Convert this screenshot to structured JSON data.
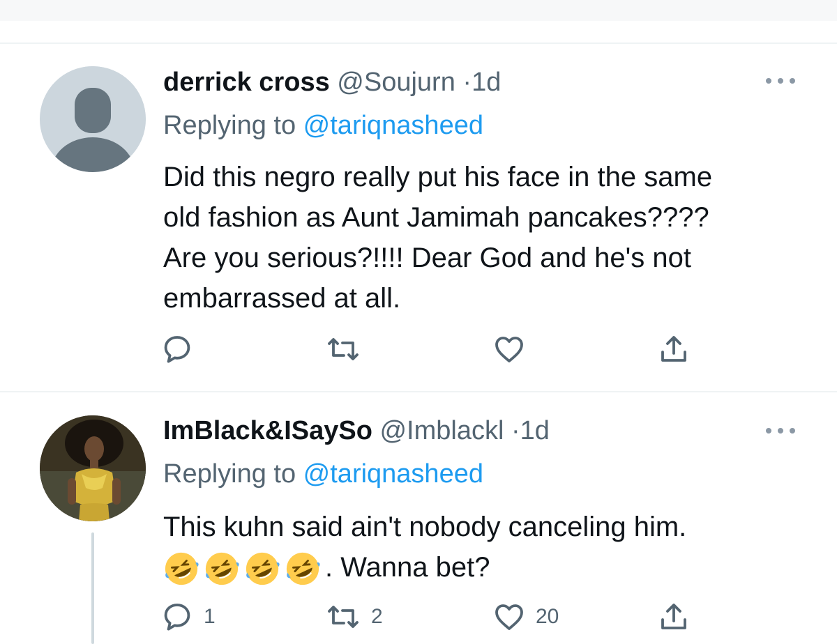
{
  "tweets": [
    {
      "name": "derrick cross",
      "handle": "@Soujurn",
      "separator": "·",
      "time": "1d",
      "replying_prefix": "Replying to ",
      "replying_to": "@tariqnasheed",
      "body_lines": [
        "Did this negro really put his face in the same",
        "old fashion as Aunt Jamimah pancakes????",
        "Are you serious?!!!! Dear God and he's not",
        "embarrassed at all."
      ],
      "actions": {
        "reply": "",
        "retweet": "",
        "like": "",
        "share": ""
      },
      "avatar": "default-avatar-icon"
    },
    {
      "name": "ImBlack&ISaySo",
      "handle": "@Imblackl",
      "separator": "·",
      "time": "1d",
      "replying_prefix": "Replying to ",
      "replying_to": "@tariqnasheed",
      "body_lines": [
        "This kuhn said ain't nobody canceling him.",
        ". Wanna bet?"
      ],
      "emoji": "rolling-on-floor-laughing-emoji",
      "emoji_count": 4,
      "actions": {
        "reply": "1",
        "retweet": "2",
        "like": "20",
        "share": ""
      },
      "avatar": "profile-photo"
    }
  ],
  "colors": {
    "text": "#0f1419",
    "secondary": "#536471",
    "link": "#1d9bf0",
    "icon": "#536471",
    "divider": "#eff3f4"
  },
  "icons": [
    "more-icon",
    "reply-icon",
    "retweet-icon",
    "like-icon",
    "share-icon"
  ]
}
